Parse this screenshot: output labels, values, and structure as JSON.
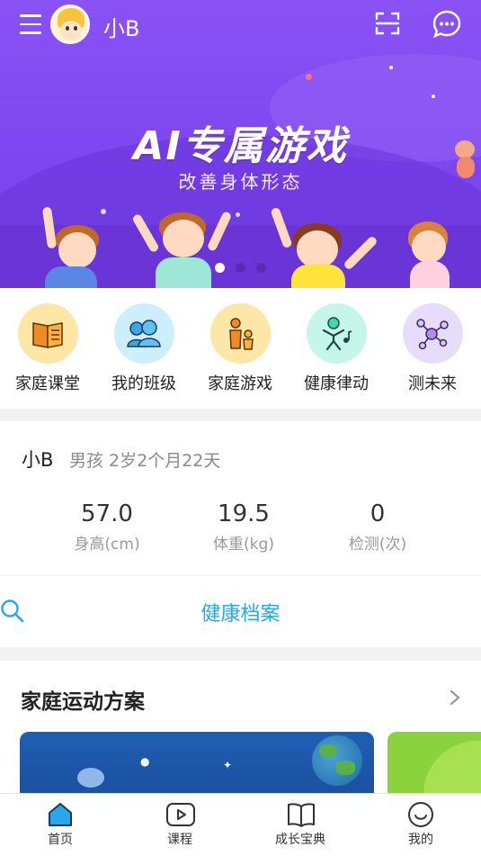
{
  "header": {
    "username": "小B"
  },
  "banner": {
    "title": "AI专属游戏",
    "subtitle": "改善身体形态",
    "dots_count": 3,
    "active_dot": 1
  },
  "categories": [
    {
      "label": "家庭课堂",
      "icon": "book-icon",
      "bg": "#fde7a6"
    },
    {
      "label": "我的班级",
      "icon": "class-people-icon",
      "bg": "#cdeefd"
    },
    {
      "label": "家庭游戏",
      "icon": "family-icon",
      "bg": "#fde7a6"
    },
    {
      "label": "健康律动",
      "icon": "dance-music-icon",
      "bg": "#c6f5ea"
    },
    {
      "label": "测未来",
      "icon": "network-icon",
      "bg": "#e7dcfa"
    }
  ],
  "profile": {
    "name": "小B",
    "info": "男孩 2岁2个月22天",
    "stats": [
      {
        "value": "57.0",
        "label": "身高(cm)"
      },
      {
        "value": "19.5",
        "label": "体重(kg)"
      },
      {
        "value": "0",
        "label": "检测(次)"
      }
    ],
    "health_link": "健康档案"
  },
  "plan": {
    "title": "家庭运动方案"
  },
  "bottom_nav": [
    {
      "label": "首页",
      "icon": "home-icon",
      "active": true
    },
    {
      "label": "课程",
      "icon": "video-play-icon",
      "active": false
    },
    {
      "label": "成长宝典",
      "icon": "open-book-icon",
      "active": false
    },
    {
      "label": "我的",
      "icon": "smile-icon",
      "active": false
    }
  ],
  "colors": {
    "banner_purple": "#7c46ef",
    "accent_blue": "#29a6ec",
    "active_nav": "#29a6ec"
  }
}
